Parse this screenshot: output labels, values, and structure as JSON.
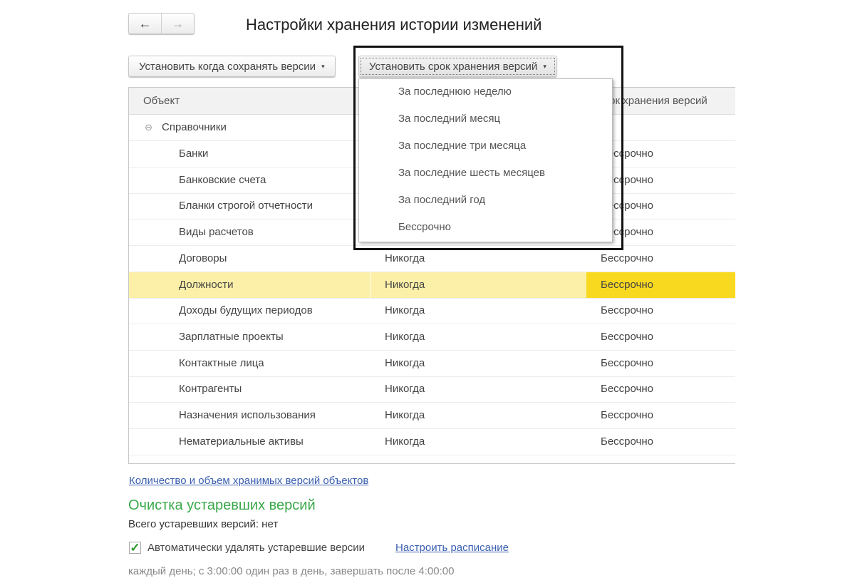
{
  "header": {
    "title": "Настройки хранения истории изменений",
    "back": "←",
    "forward": "→"
  },
  "toolbar": {
    "when_label": "Установить когда сохранять версии",
    "term_label": "Установить срок хранения версий",
    "caret": "▾"
  },
  "table": {
    "columns": [
      "Объект",
      "Срок хранения версий"
    ],
    "group": {
      "icon": "⊖",
      "label": "Справочники"
    },
    "rows": [
      {
        "object": "Банки",
        "when": "",
        "term": "Бессрочно"
      },
      {
        "object": "Банковские счета",
        "when": "",
        "term": "Бессрочно"
      },
      {
        "object": "Бланки строгой отчетности",
        "when": "",
        "term": "Бессрочно"
      },
      {
        "object": "Виды расчетов",
        "when": "",
        "term": "Бессрочно"
      },
      {
        "object": "Договоры",
        "when": "Никогда",
        "term": "Бессрочно"
      },
      {
        "object": "Должности",
        "when": "Никогда",
        "term": "Бессрочно",
        "selected": true
      },
      {
        "object": "Доходы будущих периодов",
        "when": "Никогда",
        "term": "Бессрочно"
      },
      {
        "object": "Зарплатные проекты",
        "when": "Никогда",
        "term": "Бессрочно"
      },
      {
        "object": "Контактные лица",
        "when": "Никогда",
        "term": "Бессрочно"
      },
      {
        "object": "Контрагенты",
        "when": "Никогда",
        "term": "Бессрочно"
      },
      {
        "object": "Назначения использования",
        "when": "Никогда",
        "term": "Бессрочно"
      },
      {
        "object": "Нематериальные активы",
        "when": "Никогда",
        "term": "Бессрочно"
      }
    ]
  },
  "menu": {
    "items": [
      "За последнюю неделю",
      "За последний месяц",
      "За последние три месяца",
      "За последние шесть месяцев",
      "За последний год",
      "Бессрочно"
    ]
  },
  "footer": {
    "versions_link": "Количество и объем хранимых версий объектов",
    "cleanup_title": "Очистка устаревших версий",
    "total": "Всего устаревших версий: нет",
    "auto_delete_label": "Автоматически удалять устаревшие версии",
    "auto_delete_checked": true,
    "schedule_link": "Настроить расписание",
    "schedule_text": "каждый день; с 3:00:00 один раз в день, завершать после 4:00:00"
  },
  "colors": {
    "selected_row": "#fcf0a8",
    "selected_cell": "#f9d920",
    "green": "#3aa84a",
    "link": "#3a5fb0"
  }
}
